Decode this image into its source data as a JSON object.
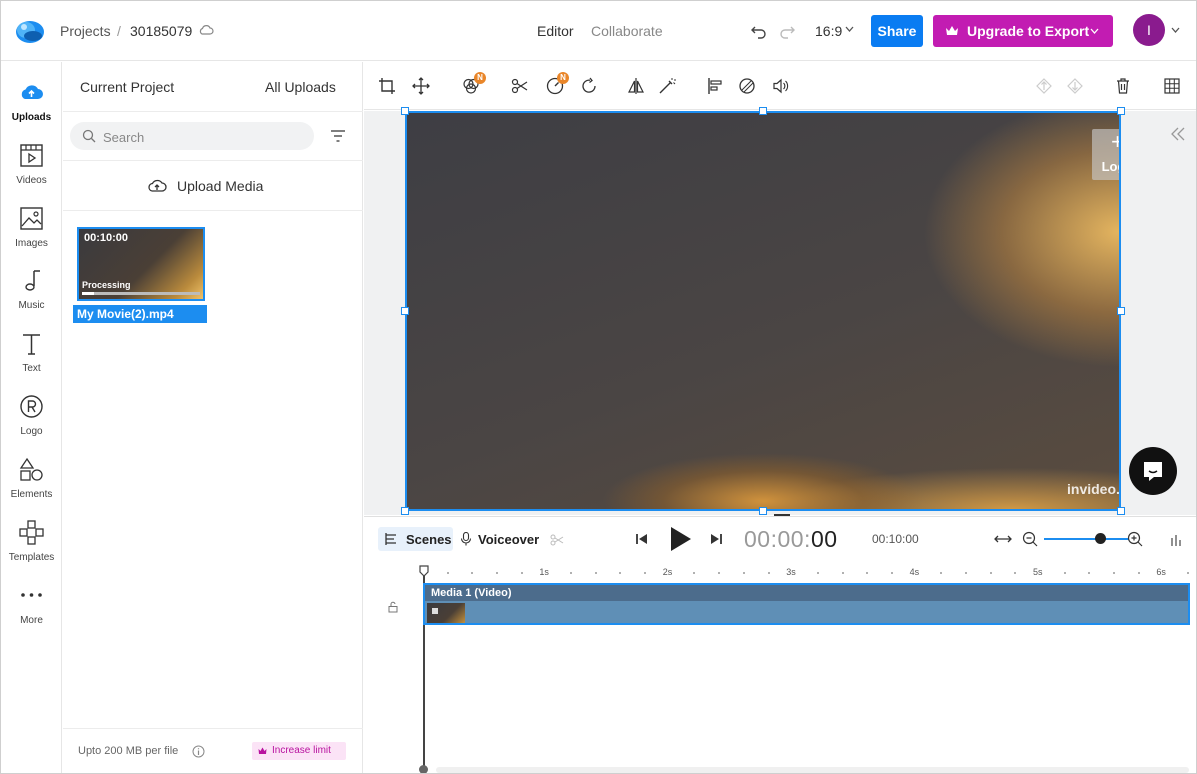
{
  "header": {
    "breadcrumb_root": "Projects",
    "breadcrumb_sep": "/",
    "project_id": "30185079",
    "tabs": [
      {
        "label": "Editor"
      },
      {
        "label": "Collaborate"
      }
    ],
    "aspect_ratio": "16:9",
    "share_label": "Share",
    "upgrade_label": "Upgrade to Export",
    "avatar_initial": "I",
    "brand_color": "#c21cb2",
    "share_color": "#0a7cf2"
  },
  "rail": {
    "items": [
      {
        "label": "Uploads",
        "icon": "cloud-upload-icon",
        "active": true
      },
      {
        "label": "Videos",
        "icon": "film-icon"
      },
      {
        "label": "Images",
        "icon": "image-icon"
      },
      {
        "label": "Music",
        "icon": "music-note-icon"
      },
      {
        "label": "Text",
        "icon": "text-t-icon"
      },
      {
        "label": "Logo",
        "icon": "registered-icon"
      },
      {
        "label": "Elements",
        "icon": "shapes-icon"
      },
      {
        "label": "Templates",
        "icon": "templates-grid-icon"
      },
      {
        "label": "More",
        "icon": "more-dots-icon"
      }
    ]
  },
  "panel": {
    "tabs": [
      {
        "label": "Current Project"
      },
      {
        "label": "All Uploads"
      }
    ],
    "search_placeholder": "Search",
    "upload_label": "Upload Media",
    "media": [
      {
        "duration": "00:10:00",
        "status": "Processing",
        "name": "My Movie(2).mp4",
        "progress": 0.1
      }
    ],
    "limit_text": "Upto 200 MB per file",
    "increase_label": "Increase limit"
  },
  "toolbar": {
    "badge_new": "N"
  },
  "canvas": {
    "logo_plus": "+",
    "logo_label": "Logo",
    "watermark": "invideo.io"
  },
  "timeline": {
    "scenes_label": "Scenes",
    "voiceover_label": "Voiceover",
    "current_time_prefix": "00:00:",
    "current_time_last": "00",
    "total_time": "00:10:00",
    "ruler_labels": [
      "1s",
      "2s",
      "3s",
      "4s",
      "5s",
      "6s"
    ],
    "track_label": "Media 1 (Video)",
    "zoom_level": 0.7
  }
}
